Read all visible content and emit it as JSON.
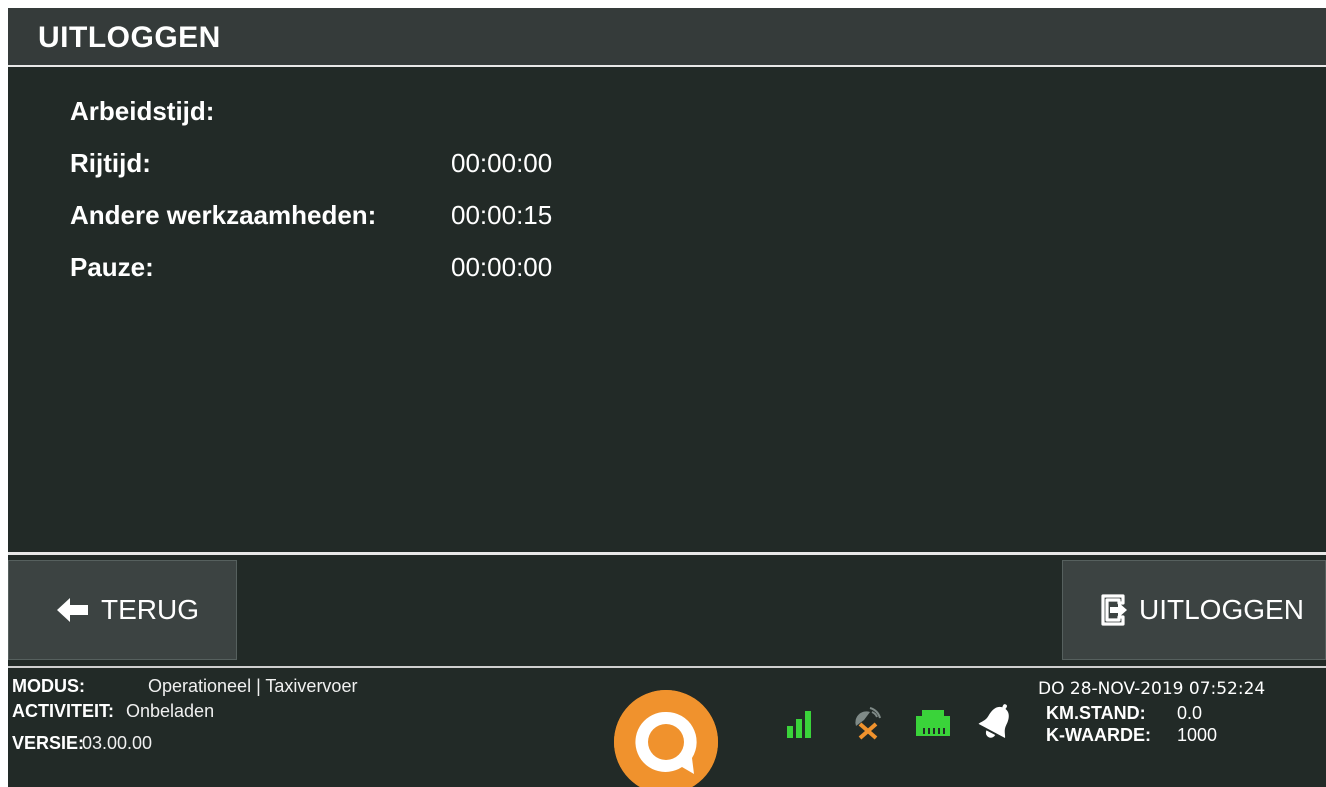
{
  "header": {
    "title": "UITLOGGEN"
  },
  "summary": {
    "rows": [
      {
        "label": "Arbeidstijd:",
        "value": ""
      },
      {
        "label": "Rijtijd:",
        "value": "00:00:00"
      },
      {
        "label": "Andere werkzaamheden:",
        "value": "00:00:15"
      },
      {
        "label": "Pauze:",
        "value": "00:00:00"
      }
    ]
  },
  "buttons": {
    "back_label": "TERUG",
    "logout_label": "UITLOGGEN"
  },
  "footer": {
    "modus_key": "MODUS:",
    "modus_value": "Operationeel | Taxivervoer",
    "activiteit_key": "ACTIVITEIT:",
    "activiteit_value": "Onbeladen",
    "versie_key": "VERSIE:",
    "versie_value": "03.00.00",
    "datetime": "DO 28-NOV-2019 07:52:24",
    "km_key": "KM.STAND:",
    "km_value": "0.0",
    "k_key": "K-WAARDE:",
    "k_value": "1000"
  },
  "icons": {
    "back": "arrow-left-icon",
    "logout": "sign-out-icon",
    "signal": "signal-bars-icon",
    "gps": "gps-disconnected-icon",
    "network": "ethernet-icon",
    "bell": "bell-icon",
    "logo": "q-logo-icon"
  },
  "colors": {
    "background": "#222a27",
    "header": "#353b3a",
    "button": "#3c4342",
    "status_green": "#3ad33a",
    "status_orange": "#f0922d",
    "logo_orange": "#f0922d"
  }
}
